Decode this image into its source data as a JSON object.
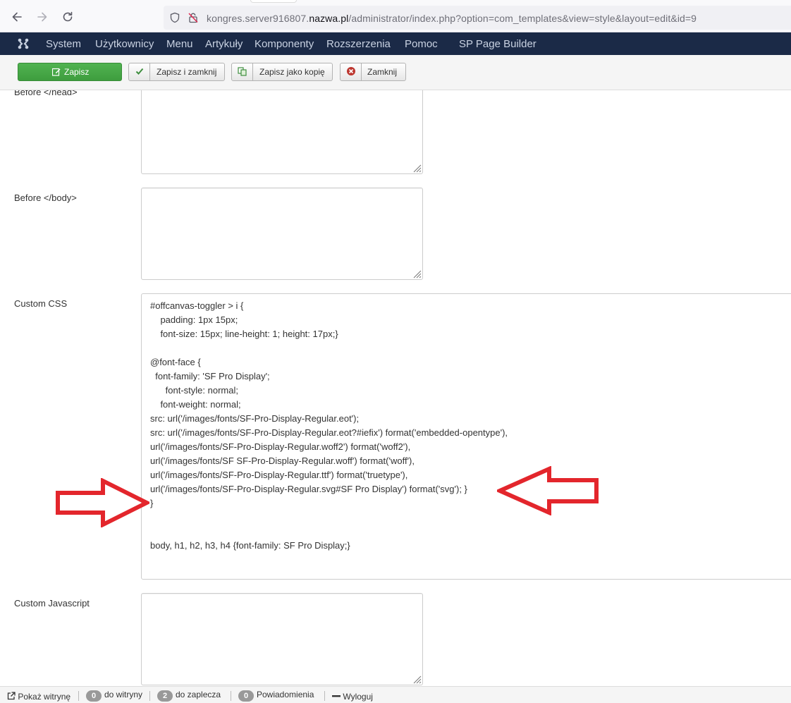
{
  "browser": {
    "url_prefix": "kongres.server916807.",
    "url_domain": "nazwa.pl",
    "url_suffix": "/administrator/index.php?option=com_templates&view=style&layout=edit&id=9",
    "icons": [
      "back-arrow-icon",
      "forward-arrow-icon",
      "reload-icon",
      "shield-icon",
      "insecure-lock-icon"
    ]
  },
  "admin_menu": {
    "items": [
      "System",
      "Użytkownicy",
      "Menu",
      "Artykuły",
      "Komponenty",
      "Rozszerzenia",
      "Pomoc",
      "SP Page Builder"
    ],
    "background": "#1b2a47"
  },
  "toolbar": {
    "save": "Zapisz",
    "save_close": "Zapisz i zamknij",
    "save_copy": "Zapisz jako kopię",
    "close": "Zamknij",
    "save_color": "#46a546"
  },
  "fields": {
    "before_head_label": "Before </head>",
    "before_body_label": "Before </body>",
    "custom_css_label": "Custom CSS",
    "custom_js_label": "Custom Javascript",
    "custom_css_lines": [
      "#offcanvas-toggler > i {",
      "    padding: 1px 15px;",
      "    font-size: 15px; line-height: 1; height: 17px;}",
      "",
      "@font-face {",
      "  font-family: 'SF Pro Display';",
      "      font-style: normal;",
      "    font-weight: normal;",
      "src: url('/images/fonts/SF-Pro-Display-Regular.eot');",
      "src: url('/images/fonts/SF-Pro-Display-Regular.eot?#iefix') format('embedded-opentype'),",
      "url('/images/fonts/SF-Pro-Display-Regular.woff2') format('woff2'),",
      "url('/images/fonts/SF SF-Pro-Display-Regular.woff') format('woff'),",
      "url('/images/fonts/SF-Pro-Display-Regular.ttf') format('truetype'),",
      "url('/images/fonts/SF-Pro-Display-Regular.svg#SF Pro Display') format('svg'); }",
      "}",
      "",
      "",
      "body, h1, h2, h3, h4 {font-family: SF Pro Display;}"
    ]
  },
  "annotations": {
    "arrow_color": "#e3262c"
  },
  "status_bar": {
    "show_site": "Pokaż witrynę",
    "site_count": "0",
    "site_label": "do witryny",
    "admin_count": "2",
    "admin_label": "do zaplecza",
    "notif_count": "0",
    "notif_label": "Powiadomienia",
    "logout": "Wyloguj"
  }
}
